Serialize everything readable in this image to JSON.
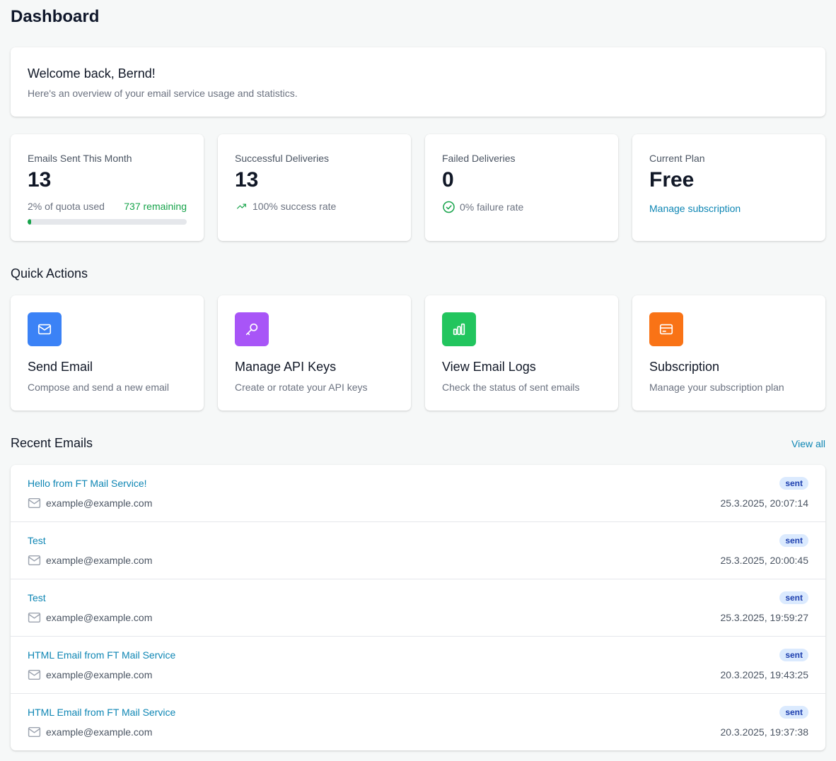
{
  "page": {
    "title": "Dashboard"
  },
  "welcome": {
    "heading": "Welcome back, Bernd!",
    "subtitle": "Here's an overview of your email service usage and statistics."
  },
  "stats": {
    "sent": {
      "label": "Emails Sent This Month",
      "value": "13",
      "quota_text": "2% of quota used",
      "remaining_text": "737 remaining",
      "quota_used_percent": 2
    },
    "success": {
      "label": "Successful Deliveries",
      "value": "13",
      "rate_text": "100% success rate",
      "icon": "trending-up-icon"
    },
    "failed": {
      "label": "Failed Deliveries",
      "value": "0",
      "rate_text": "0% failure rate",
      "icon": "check-circle-icon"
    },
    "plan": {
      "label": "Current Plan",
      "value": "Free",
      "link": "Manage subscription"
    }
  },
  "quick_actions": {
    "title": "Quick Actions",
    "items": [
      {
        "title": "Send Email",
        "description": "Compose and send a new email",
        "icon": "mail-icon",
        "color": "#3b82f6"
      },
      {
        "title": "Manage API Keys",
        "description": "Create or rotate your API keys",
        "icon": "key-icon",
        "color": "#a855f7"
      },
      {
        "title": "View Email Logs",
        "description": "Check the status of sent emails",
        "icon": "bar-chart-icon",
        "color": "#22c55e"
      },
      {
        "title": "Subscription",
        "description": "Manage your subscription plan",
        "icon": "credit-card-icon",
        "color": "#f97316"
      }
    ]
  },
  "recent_emails": {
    "title": "Recent Emails",
    "view_all": "View all",
    "rows": [
      {
        "subject": "Hello from FT Mail Service!",
        "to": "example@example.com",
        "status": "sent",
        "timestamp": "25.3.2025, 20:07:14"
      },
      {
        "subject": "Test",
        "to": "example@example.com",
        "status": "sent",
        "timestamp": "25.3.2025, 20:00:45"
      },
      {
        "subject": "Test",
        "to": "example@example.com",
        "status": "sent",
        "timestamp": "25.3.2025, 19:59:27"
      },
      {
        "subject": "HTML Email from FT Mail Service",
        "to": "example@example.com",
        "status": "sent",
        "timestamp": "20.3.2025, 19:43:25"
      },
      {
        "subject": "HTML Email from FT Mail Service",
        "to": "example@example.com",
        "status": "sent",
        "timestamp": "20.3.2025, 19:37:38"
      }
    ]
  },
  "colors": {
    "accent": "#0e86b4",
    "success": "#16a34a",
    "badge_bg": "#dbeafe",
    "badge_text": "#1e40af"
  }
}
